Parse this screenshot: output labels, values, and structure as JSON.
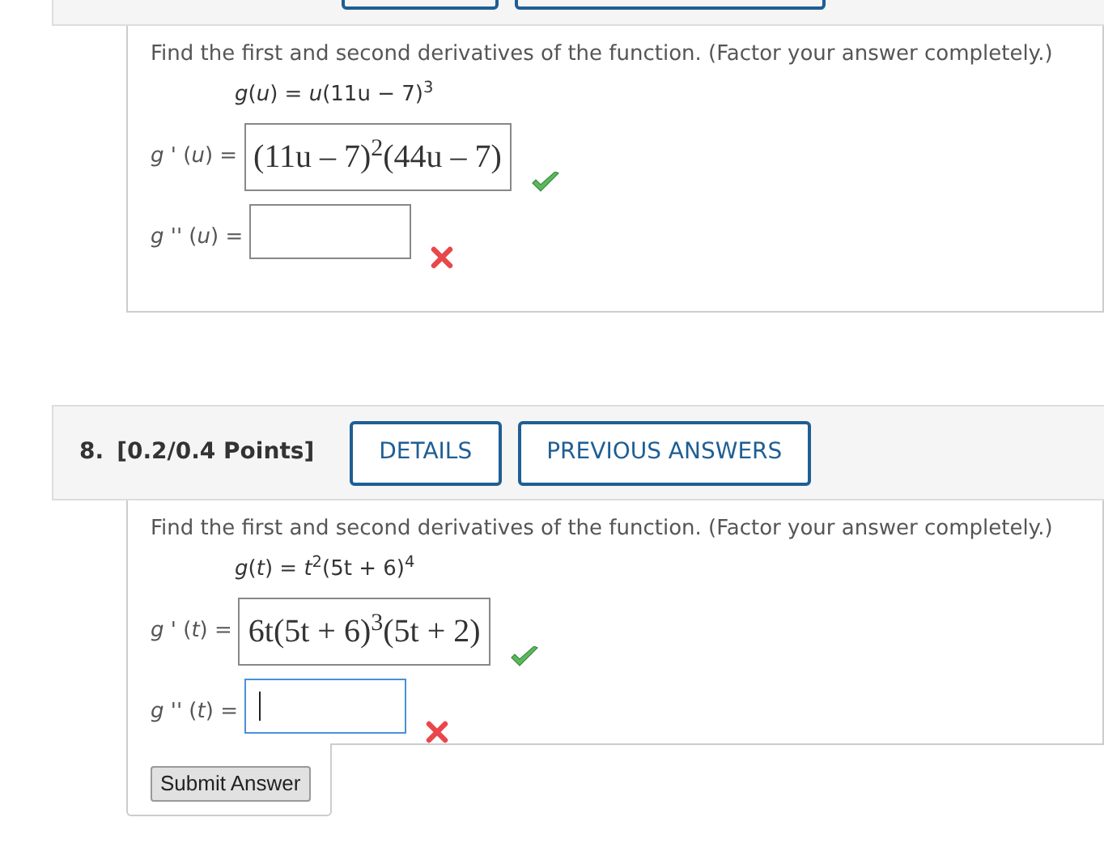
{
  "questions": [
    {
      "prompt": "Find the first and second derivatives of the function. (Factor your answer completely.)",
      "function": "*g*(*u*) = *u*(11u − 7)$^{3}$",
      "answers": [
        {
          "label": "*g* ' (*u*) =",
          "value": "(11u – 7)$^{2}$(44u – 7)",
          "kind": "correct",
          "focused": false
        },
        {
          "label": "*g* '' (*u*) =",
          "kind": "incorrect",
          "focused": false
        }
      ]
    },
    {
      "header": {
        "number": "8.",
        "points": "[0.2/0.4 Points]",
        "buttons": [
          "DETAILS",
          "PREVIOUS ANSWERS"
        ]
      },
      "prompt": "Find the first and second derivatives of the function. (Factor your answer completely.)",
      "function": "*g*(*t*) = *t*$^{2}$(5t + 6)$^{4}$",
      "answers": [
        {
          "label": "*g* ' (*t*) =",
          "value": "6t(5t + 6)$^{3}$(5t + 2)",
          "kind": "correct",
          "focused": false
        },
        {
          "label": "*g* '' (*t*) =",
          "kind": "incorrect",
          "focused": true
        }
      ],
      "submit": "Submit Answer"
    }
  ]
}
